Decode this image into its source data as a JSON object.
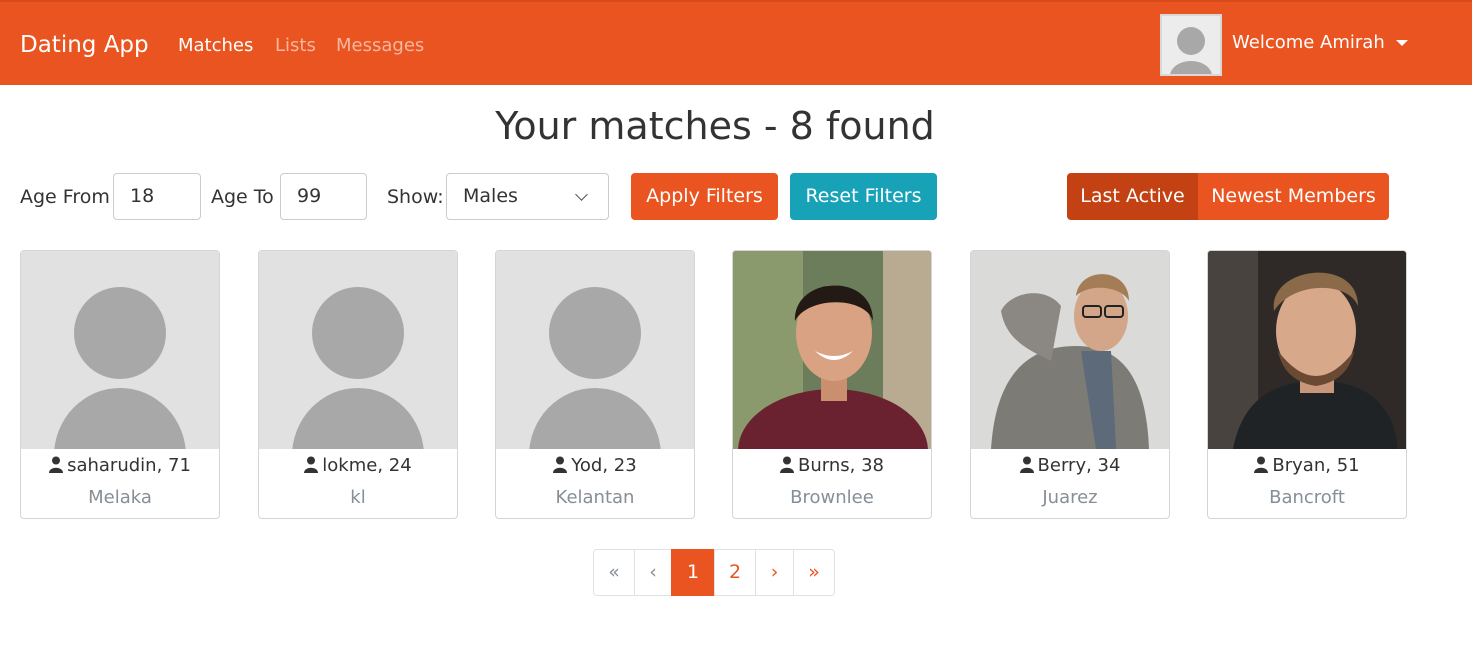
{
  "navbar": {
    "brand": "Dating App",
    "links": [
      "Matches",
      "Lists",
      "Messages"
    ],
    "welcome": "Welcome Amirah",
    "colors": {
      "primary": "#e95420",
      "info": "#17a2b8"
    }
  },
  "title": "Your matches - 8 found",
  "filters": {
    "age_from_label": "Age From",
    "age_from_value": "18",
    "age_to_label": "Age To",
    "age_to_value": "99",
    "show_label": "Show:",
    "show_value": "Males",
    "apply_label": "Apply Filters",
    "reset_label": "Reset Filters",
    "sort_last_active": "Last Active",
    "sort_newest": "Newest Members"
  },
  "members": [
    {
      "name": "saharudin, 71",
      "city": "Melaka",
      "photo": "placeholder"
    },
    {
      "name": "lokme, 24",
      "city": "kl",
      "photo": "placeholder"
    },
    {
      "name": "Yod, 23",
      "city": "Kelantan",
      "photo": "placeholder"
    },
    {
      "name": "Burns, 38",
      "city": "Brownlee",
      "photo": "photo"
    },
    {
      "name": "Berry, 34",
      "city": "Juarez",
      "photo": "photo"
    },
    {
      "name": "Bryan, 51",
      "city": "Bancroft",
      "photo": "photo"
    }
  ],
  "pagination": {
    "first": "«",
    "prev": "‹",
    "pages": [
      "1",
      "2"
    ],
    "next": "›",
    "last": "»",
    "current": "1"
  }
}
